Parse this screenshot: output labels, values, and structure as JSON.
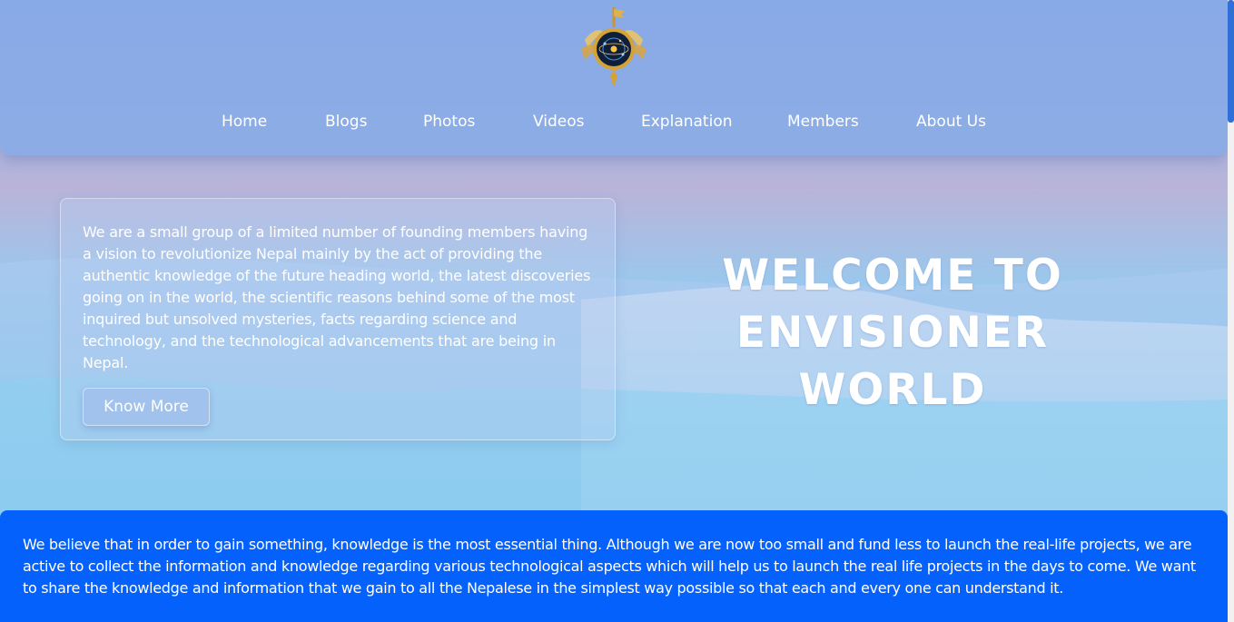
{
  "header": {
    "logo_icon": "compass-emblem-icon"
  },
  "nav": {
    "items": [
      {
        "label": "Home"
      },
      {
        "label": "Blogs"
      },
      {
        "label": "Photos"
      },
      {
        "label": "Videos"
      },
      {
        "label": "Explanation"
      },
      {
        "label": "Members"
      },
      {
        "label": "About Us"
      }
    ]
  },
  "intro": {
    "text": "We are a small group of a limited number of founding members having a vision to revolutionize Nepal mainly by the act of providing the authentic knowledge of the future heading world, the latest discoveries going on in the world, the scientific reasons behind some of the most inquired but unsolved mysteries, facts regarding science and technology, and the technological advancements that are being in Nepal.",
    "button_label": "Know More"
  },
  "hero": {
    "line1": "WELCOME TO",
    "line2": "ENVISIONER WORLD"
  },
  "belief": {
    "text": "We believe that in order to gain something, knowledge is the most essential thing. Although we are now too small and fund less to launch the real-life projects, we are active to collect the information and knowledge regarding various technological aspects which will help us to launch the real life projects in the days to come. We want to share the knowledge and information that we gain to all the Nepalese in the simplest way possible so that each and every one can understand it."
  },
  "colors": {
    "belief_background": "#0561fc",
    "header_background": "#87aae8",
    "scrollbar_thumb": "#2f6fd8"
  }
}
